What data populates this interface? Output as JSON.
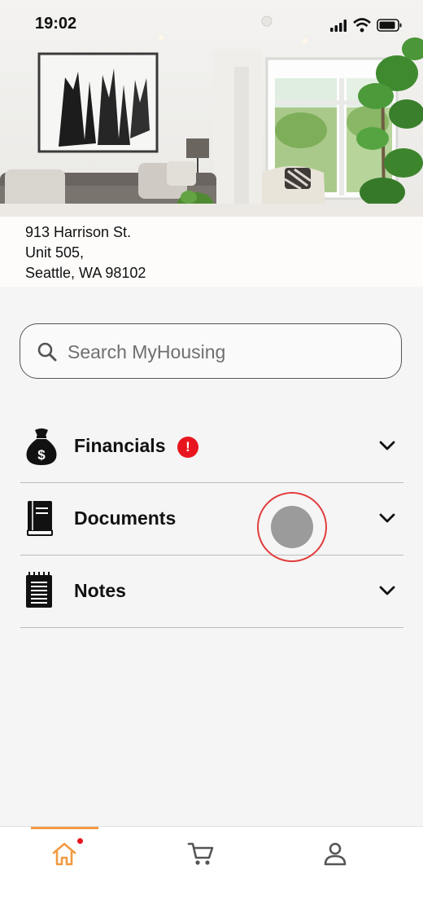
{
  "status_bar": {
    "time": "19:02"
  },
  "property": {
    "address_line1": "913 Harrison St.",
    "address_line2": "Unit 505,",
    "address_line3": "Seattle, WA 98102"
  },
  "search": {
    "placeholder": "Search MyHousing",
    "value": ""
  },
  "sections": [
    {
      "label": "Financials",
      "icon": "money-bag-icon",
      "alert": "!"
    },
    {
      "label": "Documents",
      "icon": "book-icon"
    },
    {
      "label": "Notes",
      "icon": "notepad-icon"
    }
  ],
  "bottom_nav": {
    "items": [
      {
        "icon": "home-icon",
        "active": true,
        "notification": true
      },
      {
        "icon": "cart-icon",
        "active": false
      },
      {
        "icon": "profile-icon",
        "active": false
      }
    ]
  },
  "colors": {
    "accent": "#f29a43",
    "alert": "#e8151f",
    "background": "#f5f5f5"
  }
}
